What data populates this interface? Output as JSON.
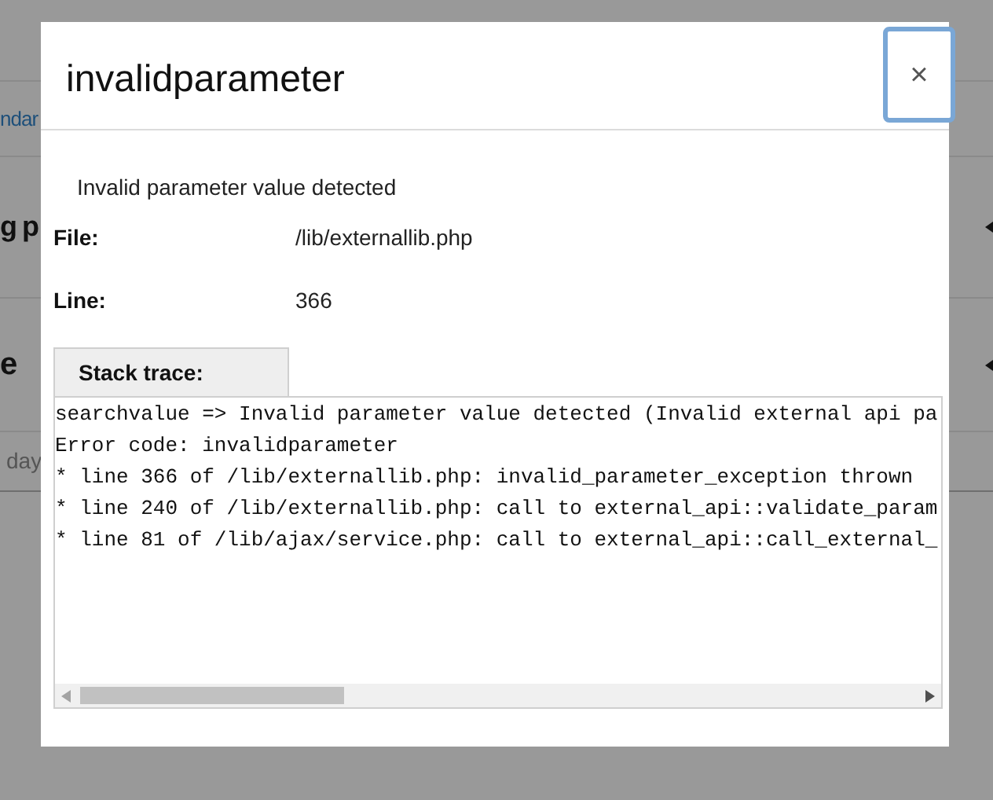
{
  "background_page": {
    "link_fragment": "ndar",
    "heading_fragments": [
      "g p",
      "e"
    ],
    "muted_fragment": "day"
  },
  "dialog": {
    "title": "invalidparameter",
    "close_label": "×",
    "message": "Invalid parameter value detected",
    "fields": [
      {
        "label": "File:",
        "value": "/lib/externallib.php"
      },
      {
        "label": "Line:",
        "value": "366"
      }
    ],
    "stack_trace": {
      "tab": "Stack trace:",
      "lines": [
        "searchvalue => Invalid parameter value detected (Invalid external api pa",
        "Error code: invalidparameter",
        "* line 366 of /lib/externallib.php: invalid_parameter_exception thrown",
        "* line 240 of /lib/externallib.php: call to external_api::validate_param",
        "* line 81 of /lib/ajax/service.php: call to external_api::call_external_"
      ]
    }
  }
}
